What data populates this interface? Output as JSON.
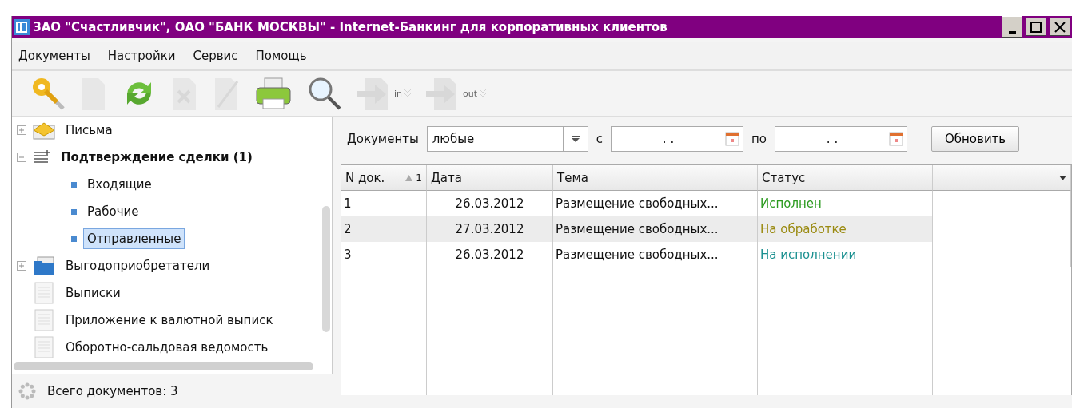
{
  "window": {
    "title": "ЗАО \"Счастливчик\", ОАО \"БАНК МОСКВЫ\" - Internet-Банкинг для корпоративных клиентов"
  },
  "menu": [
    "Документы",
    "Настройки",
    "Сервис",
    "Помощь"
  ],
  "toolbar": [
    {
      "kind": "key",
      "disabled": false
    },
    {
      "kind": "document",
      "disabled": true
    },
    {
      "kind": "refresh",
      "disabled": false
    },
    {
      "kind": "delete",
      "disabled": true
    },
    {
      "kind": "sign",
      "disabled": true
    },
    {
      "kind": "print",
      "disabled": false
    },
    {
      "kind": "search",
      "disabled": false
    },
    {
      "kind": "import",
      "label": "in",
      "disabled": true
    },
    {
      "kind": "export",
      "label": "out",
      "disabled": true
    }
  ],
  "tree": [
    {
      "label": "Письма",
      "kind": "mail",
      "expanded": false,
      "bold": false,
      "selected": false
    },
    {
      "label": "Подтверждение сделки (1)",
      "kind": "list",
      "expanded": true,
      "bold": true,
      "selected": false,
      "children": [
        {
          "label": "Входящие",
          "kind": "bullet",
          "selected": false
        },
        {
          "label": "Рабочие",
          "kind": "bullet",
          "selected": false
        },
        {
          "label": "Отправленные",
          "kind": "bullet",
          "selected": true
        }
      ]
    },
    {
      "label": "Выгодоприобретатели",
      "kind": "folder",
      "expanded": false,
      "bold": false,
      "selected": false
    },
    {
      "label": "Выписки",
      "kind": "doc",
      "bold": false,
      "selected": false
    },
    {
      "label": "Приложение к валютной выписк",
      "kind": "doc",
      "bold": false,
      "selected": false
    },
    {
      "label": "Оборотно-сальдовая ведомость",
      "kind": "doc",
      "bold": false,
      "selected": false
    }
  ],
  "filter": {
    "label": "Документы",
    "type": {
      "value": "любые"
    },
    "from_label": "с",
    "from": {
      "value": ".  ."
    },
    "to_label": "по",
    "to": {
      "value": ".  ."
    },
    "button": "Обновить"
  },
  "table": {
    "columns": [
      {
        "label": "N док.",
        "sort_order": "1"
      },
      {
        "label": "Дата"
      },
      {
        "label": "Тема"
      },
      {
        "label": "Статус"
      }
    ],
    "rows": [
      {
        "number": "1",
        "date": "26.03.2012",
        "subject": "Размещение свободных...",
        "status": "Исполнен",
        "color": "#2a9a1e",
        "selected": false
      },
      {
        "number": "2",
        "date": "27.03.2012",
        "subject": "Размещение свободных...",
        "status": "На обработке",
        "color": "#9a8a10",
        "selected": true
      },
      {
        "number": "3",
        "date": "26.03.2012",
        "subject": "Размещение свободных...",
        "status": "На исполнении",
        "color": "#1a9090",
        "selected": false
      }
    ]
  },
  "status_bar": {
    "text": "Всего документов: 3"
  }
}
